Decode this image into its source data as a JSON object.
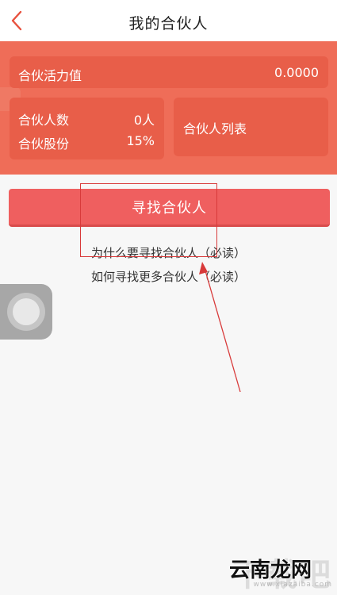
{
  "header": {
    "title": "我的合伙人",
    "back_icon": "chevron-left-icon"
  },
  "panel": {
    "vitality_label": "合伙活力值",
    "vitality_value": "0.0000",
    "partner_count_label": "合伙人数",
    "partner_count_value": "0人",
    "share_label": "合伙股份",
    "share_value": "15%",
    "partner_list_label": "合伙人列表"
  },
  "actions": {
    "find_partner_button": "寻找合伙人",
    "link_why": "为什么要寻找合伙人（必读）",
    "link_how": "如何寻找更多合伙人（必读）"
  },
  "watermark": {
    "big": "下载吧",
    "main": "云南龙网",
    "sub": "www.xiazaiba.com"
  },
  "colors": {
    "accent": "#ef6d58",
    "card": "#e85e49",
    "button": "#ef5f5f",
    "annotation": "#d83a3a"
  }
}
